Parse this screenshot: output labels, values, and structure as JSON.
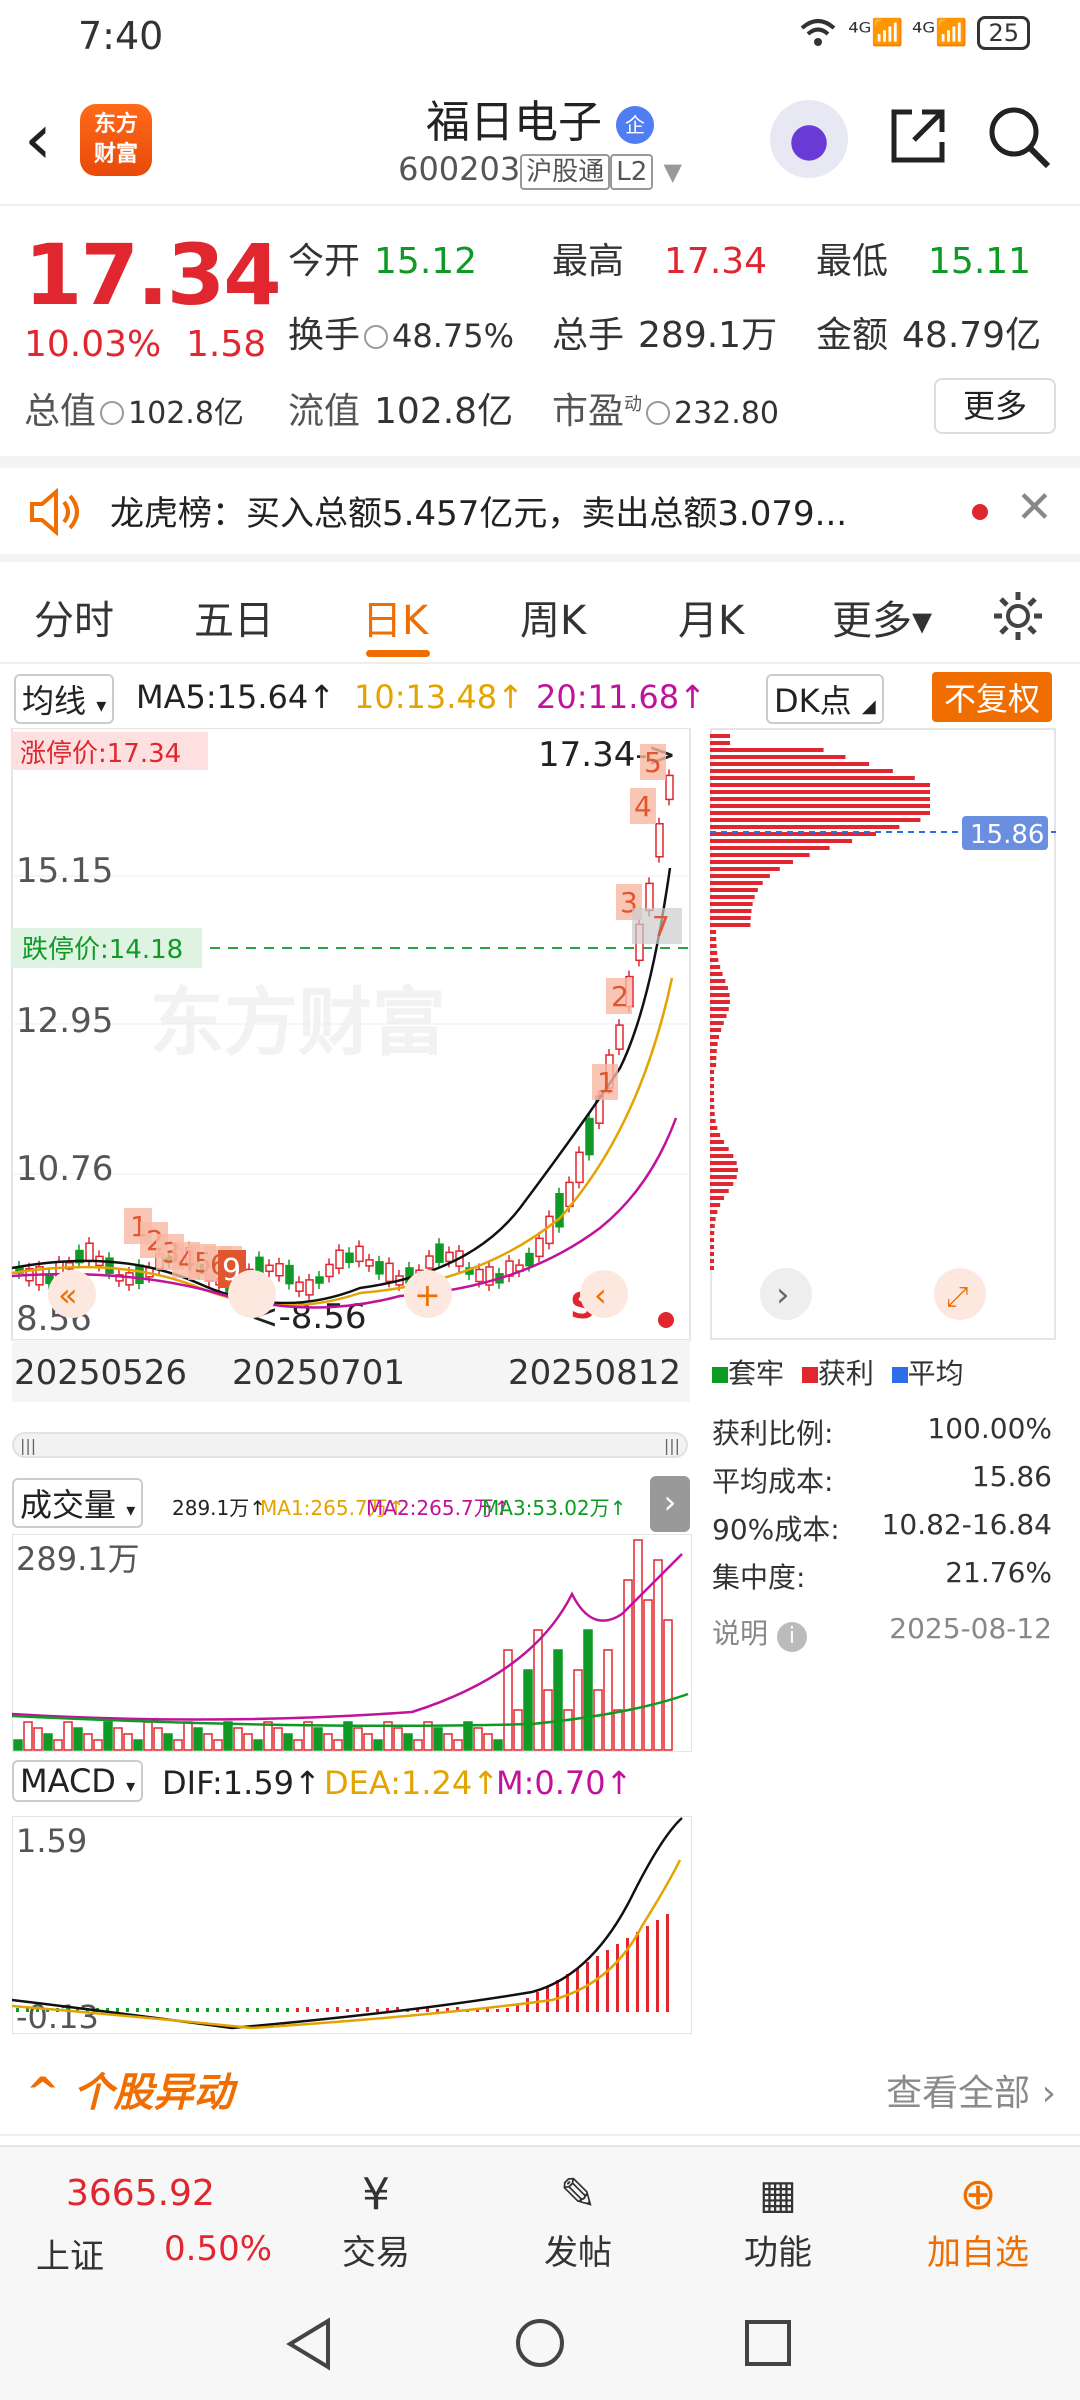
{
  "status": {
    "time": "7:40",
    "network": "⁴ᴳ📶 ⁴ᴳ📶",
    "battery": "25"
  },
  "header": {
    "logo_line1": "东方",
    "logo_line2": "财富",
    "name": "福日电子",
    "cert": "企",
    "code": "600203",
    "tag1": "沪股通",
    "tag2": "L2"
  },
  "quote": {
    "price": "17.34",
    "pct": "10.03%",
    "change": "1.58",
    "open_label": "今开",
    "open": "15.12",
    "high_label": "最高",
    "high": "17.34",
    "low_label": "最低",
    "low": "15.11",
    "turnover_label": "换手",
    "turnover": "48.75%",
    "volume_label": "总手",
    "volume": "289.1万",
    "amount_label": "金额",
    "amount": "48.79亿",
    "mktcap_label": "总值",
    "mktcap": "102.8亿",
    "float_label": "流值",
    "float": "102.8亿",
    "pe_label": "市盈",
    "pe_sup": "动",
    "pe": "232.80",
    "more": "更多"
  },
  "notice": {
    "text": "龙虎榜：买入总额5.457亿元，卖出总额3.079..."
  },
  "tabs": [
    "分时",
    "五日",
    "日K",
    "周K",
    "月K",
    "更多▾"
  ],
  "active_tab": 2,
  "ma_bar": {
    "select": "均线",
    "ma5": "MA5:15.64↑",
    "ma10": "10:13.48↑",
    "ma20": "20:11.68↑",
    "dk": "DK点",
    "fq": "不复权"
  },
  "kchart": {
    "limit_up": "涨停价:17.34",
    "limit_down": "跌停价:14.18",
    "y_labels": [
      "15.15",
      "12.95",
      "10.76",
      "8.56"
    ],
    "max_label": "17.34->",
    "min_label": "<-8.56",
    "dates": [
      "20250526",
      "20250701",
      "20250812"
    ],
    "watermark": "东方财富",
    "seq_labels": [
      "1",
      "2",
      "3",
      "4",
      "5",
      "6",
      "7",
      "1",
      "2",
      "3",
      "4",
      "5",
      "6",
      "7",
      "9"
    ],
    "s_label": "S"
  },
  "cost": {
    "avg_tag": "15.86",
    "legend": [
      "套牢",
      "获利",
      "平均"
    ],
    "rows": [
      {
        "k": "获利比例:",
        "v": "100.00%"
      },
      {
        "k": "平均成本:",
        "v": "15.86"
      },
      {
        "k": "90%成本:",
        "v": "10.82-16.84"
      },
      {
        "k": "集中度:",
        "v": "21.76%"
      }
    ],
    "note": "说明",
    "date": "2025-08-12"
  },
  "vol": {
    "select": "成交量",
    "v": "289.1万↑",
    "ma1": "MA1:265.7万↑",
    "ma2": "MA2:265.7万↑",
    "ma3": "MA3:53.02万↑",
    "top": "289.1万"
  },
  "macd": {
    "select": "MACD",
    "dif": "DIF:1.59↑",
    "dea": "DEA:1.24↑",
    "m": "M:0.70↑",
    "top": "1.59",
    "bottom": "-0.13"
  },
  "anomaly": {
    "title": "个股异动",
    "link": "查看全部"
  },
  "bottom": {
    "index_value": "3665.92",
    "index_name": "上证",
    "index_pct": "0.50%",
    "trade": "交易",
    "post": "发帖",
    "func": "功能",
    "add": "加自选"
  },
  "colors": {
    "up": "#e0262f",
    "down": "#0f9a26",
    "accent": "#f06d00"
  }
}
